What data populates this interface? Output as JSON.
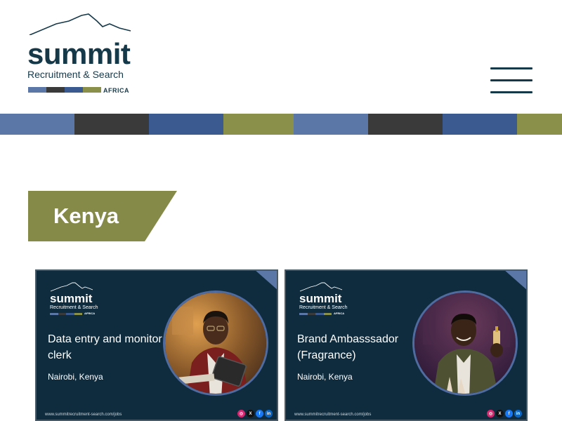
{
  "header": {
    "logo": {
      "word": "summit",
      "subtitle": "Recruitment & Search",
      "region": "AFRICA",
      "bar_colors": [
        "#5b77a8",
        "#3a3a3a",
        "#3b5a8f",
        "#8a8f4a"
      ]
    },
    "menu_icon": "hamburger-menu-icon"
  },
  "stripe_colors": [
    "#5b77a8",
    "#3a3a3a",
    "#3b5a8f",
    "#8a8f4a",
    "#5b77a8",
    "#3a3a3a",
    "#3b5a8f",
    "#8a8f4a"
  ],
  "country_heading": "Kenya",
  "country_color": "#868a48",
  "cards": [
    {
      "logo_word": "summit",
      "logo_subtitle": "Recruitment & Search",
      "logo_region": "AFRICA",
      "title": "Data entry and monitor clerk",
      "location": "Nairobi, Kenya",
      "url": "www.summitrecruitment-search.com/jobs",
      "photo": "man-with-tablet-photo"
    },
    {
      "logo_word": "summit",
      "logo_subtitle": "Recruitment & Search",
      "logo_region": "AFRICA",
      "title": "Brand Ambasssador (Fragrance)",
      "location": "Nairobi, Kenya",
      "url": "www.summitrecruitment-search.com/jobs",
      "photo": "man-with-perfume-photo"
    }
  ],
  "social_icons": [
    {
      "name": "instagram-icon",
      "glyph": "◎",
      "color": "#d6286f"
    },
    {
      "name": "x-icon",
      "glyph": "X",
      "color": "#111111"
    },
    {
      "name": "facebook-icon",
      "glyph": "f",
      "color": "#1877f2"
    },
    {
      "name": "linkedin-icon",
      "glyph": "in",
      "color": "#0a66c2"
    }
  ]
}
